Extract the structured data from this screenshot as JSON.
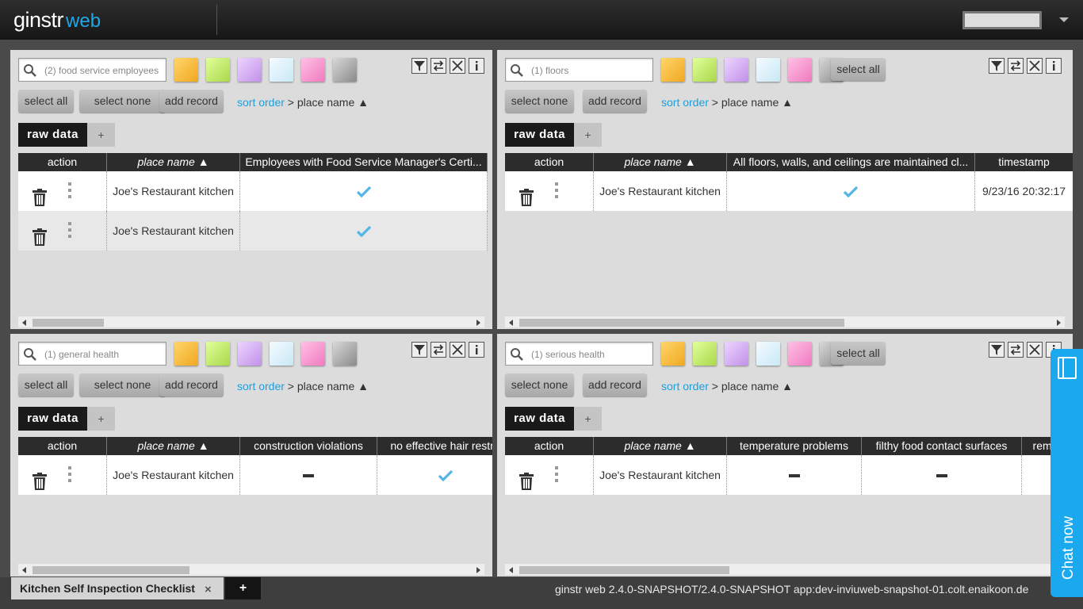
{
  "app": {
    "logo_main": "ginstr",
    "logo_sub": "web"
  },
  "panels": [
    {
      "search": "(2) food service employees",
      "buttons": [
        "select all",
        "select none",
        "add record"
      ],
      "select_all_top": "",
      "sort_link": "sort order",
      "sort_rest": " > place name ▲",
      "tab": "raw data",
      "tab_add": "+",
      "columns": [
        "action",
        "place name ▲",
        "Employees with Food Service Manager's Certi..."
      ],
      "rows": [
        [
          "",
          "Joe's Restaurant kitchen",
          "check"
        ],
        [
          "",
          "Joe's Restaurant kitchen",
          "check"
        ]
      ]
    },
    {
      "search": "(1) floors",
      "buttons": [
        "select none",
        "add record"
      ],
      "select_all_top": "select all",
      "sort_link": "sort order",
      "sort_rest": " > place name ▲",
      "tab": "raw data",
      "tab_add": "+",
      "columns": [
        "action",
        "place name ▲",
        "All floors, walls, and ceilings are maintained cl...",
        "timestamp"
      ],
      "rows": [
        [
          "",
          "Joe's Restaurant kitchen",
          "check",
          "9/23/16 20:32:17"
        ]
      ]
    },
    {
      "search": "(1) general health",
      "buttons": [
        "select all",
        "select none",
        "add record"
      ],
      "select_all_top": "",
      "sort_link": "sort order",
      "sort_rest": " > place name ▲",
      "tab": "raw data",
      "tab_add": "+",
      "columns": [
        "action",
        "place name ▲",
        "construction violations",
        "no effective hair restra"
      ],
      "rows": [
        [
          "",
          "Joe's Restaurant kitchen",
          "dash",
          "check"
        ]
      ]
    },
    {
      "search": "(1) serious health",
      "buttons": [
        "select none",
        "add record"
      ],
      "select_all_top": "select all",
      "sort_link": "sort order",
      "sort_rest": " > place name ▲",
      "tab": "raw data",
      "tab_add": "+",
      "columns": [
        "action",
        "place name ▲",
        "temperature problems",
        "filthy food contact surfaces",
        "remo"
      ],
      "rows": [
        [
          "",
          "Joe's Restaurant kitchen",
          "dash",
          "dash",
          ""
        ]
      ]
    }
  ],
  "swatch_colors": [
    "#f0a820",
    "#a8d84a",
    "#c290e8",
    "#c8e8f6",
    "#f07ac0",
    "#8a8a8a"
  ],
  "bottom": {
    "doc_tab": "Kitchen Self Inspection Checklist",
    "doc_close": "×",
    "add_tab": "+",
    "version": "ginstr web 2.4.0-SNAPSHOT/2.4.0-SNAPSHOT app:dev-inviuweb-snapshot-01.colt.enaikoon.de"
  },
  "chat": {
    "label": "Chat now"
  },
  "accent": "#1aa9ee"
}
